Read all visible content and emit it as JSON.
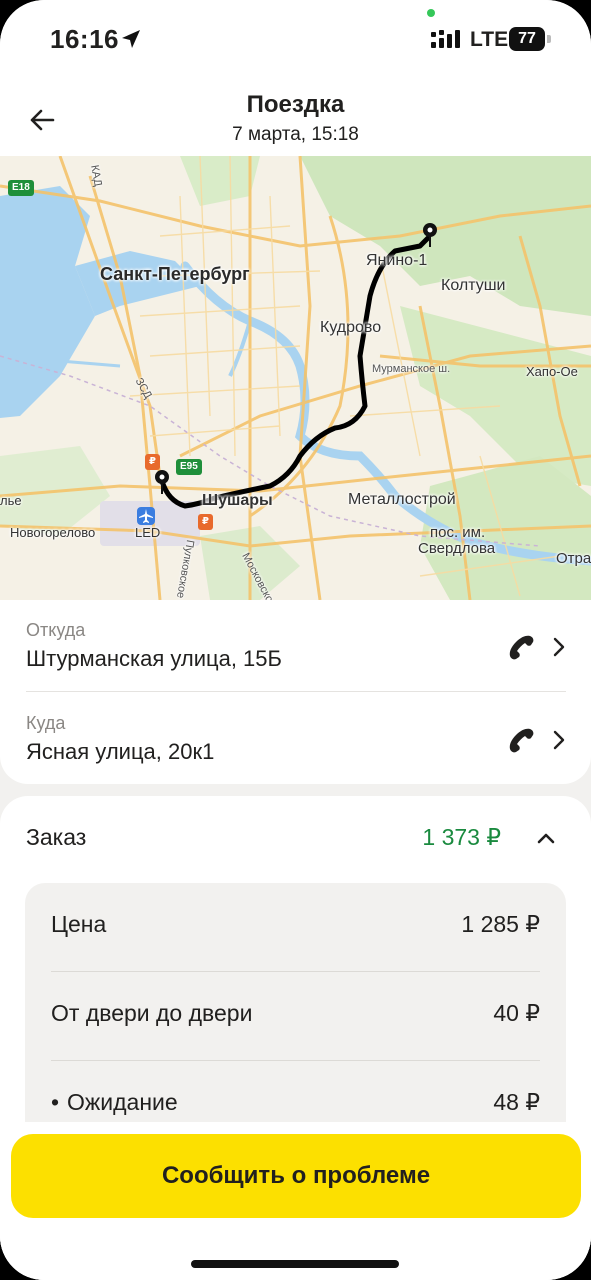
{
  "status_bar": {
    "time": "16:16",
    "network": "LTE",
    "battery": "77",
    "icons": [
      "location-arrow-icon",
      "signal-icon",
      "battery-icon"
    ]
  },
  "header": {
    "title": "Поездка",
    "subtitle": "7 марта, 15:18",
    "back_icon": "arrow-left-icon"
  },
  "map": {
    "labels": {
      "spb": "Санкт-Петербург",
      "yanino": "Янино-1",
      "koltushi": "Колтуши",
      "kudrovo": "Кудрово",
      "murmanskoe": "Мурманское ш.",
      "khapo": "Хапо-Ое",
      "shushary": "Шушары",
      "metallostroy": "Металлострой",
      "sverdlova_1": "пос. им.",
      "sverdlova_2": "Свердлова",
      "otra": "Отра",
      "novogorelovo": "Новогорелово",
      "led": "LED",
      "moskovskoe": "Московское ш.",
      "pulkovskoe": "Пулковское ш.",
      "zsd": "ЗСД",
      "kad": "КАД",
      "e18": "E18",
      "e95": "E95",
      "rub_sign": "₽",
      "left_edge": "лье"
    },
    "accent_water": "#a9d3f0",
    "accent_route": "#000000"
  },
  "route": {
    "from_caption": "Откуда",
    "from_address": "Штурманская улица, 15Б",
    "to_caption": "Куда",
    "to_address": "Ясная улица, 20к1"
  },
  "order": {
    "label": "Заказ",
    "total": "1 373 ₽",
    "total_color": "#1a8a3f",
    "items": [
      {
        "label": "Цена",
        "value": "1 285 ₽"
      },
      {
        "label": "От двери до двери",
        "value": "40 ₽"
      },
      {
        "bullet": "•",
        "label": "Ожидание",
        "value": "48 ₽"
      }
    ]
  },
  "actions": {
    "report_label": "Сообщить о проблеме",
    "report_color": "#fce000"
  }
}
